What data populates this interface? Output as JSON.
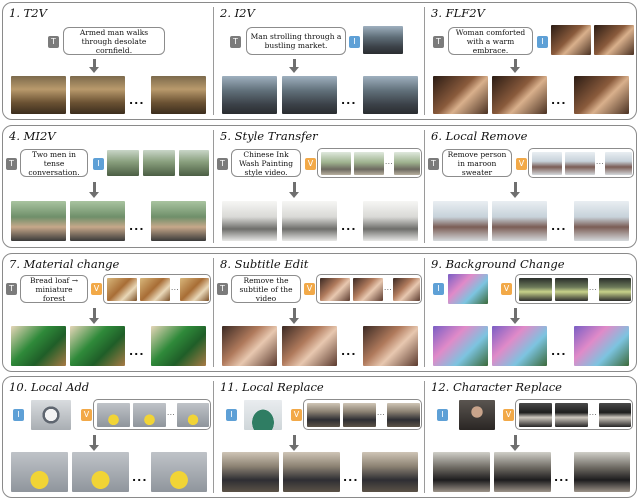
{
  "panels": [
    {
      "title": "1. T2V",
      "prompt": "Armed man walks through desolate cornfield."
    },
    {
      "title": "2. I2V",
      "prompt": "Man strolling through a bustling market."
    },
    {
      "title": "3. FLF2V",
      "prompt": "Woman comforted with a warm embrace."
    },
    {
      "title": "4. MI2V",
      "prompt": "Two men in tense conversation."
    },
    {
      "title": "5. Style Transfer",
      "prompt": "Chinese Ink Wash Painting style video."
    },
    {
      "title": "6. Local Remove",
      "prompt": "Remove person in maroon sweater"
    },
    {
      "title": "7. Material change",
      "prompt": "Bread loaf → miniature forest"
    },
    {
      "title": "8. Subtitle Edit",
      "prompt": "Remove the subtitle of the video"
    },
    {
      "title": "9. Background Change",
      "prompt": ""
    },
    {
      "title": "10. Local Add",
      "prompt": ""
    },
    {
      "title": "11. Local Replace",
      "prompt": ""
    },
    {
      "title": "12. Character Replace",
      "prompt": ""
    }
  ],
  "tags": {
    "text": "T",
    "image": "I",
    "video": "V"
  },
  "ellipsis": "...",
  "colors": {
    "text_tag": "#7b7b7b",
    "image_tag": "#5ea0d6",
    "video_tag": "#f2a948",
    "border": "#8a8a8a",
    "arrow": "#6f6f6f"
  },
  "icons": {
    "arrow": "down-arrow-icon"
  }
}
